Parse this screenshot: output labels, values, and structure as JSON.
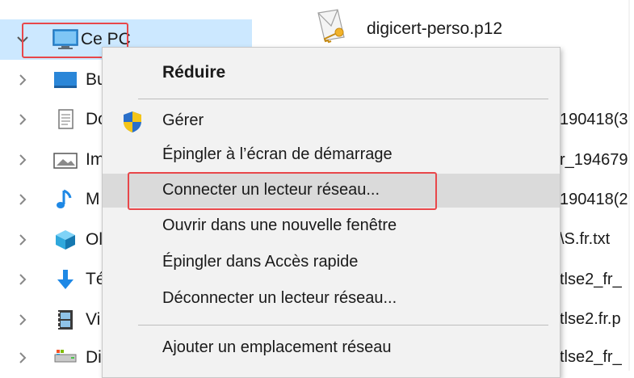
{
  "nav": {
    "items": [
      {
        "label": "Ce PC",
        "icon": "monitor-icon",
        "expanded": true
      },
      {
        "label": "Bu",
        "icon": "desktop-icon"
      },
      {
        "label": "Do",
        "icon": "documents-icon"
      },
      {
        "label": "Im",
        "icon": "images-icon"
      },
      {
        "label": "M",
        "icon": "music-icon"
      },
      {
        "label": "Ol",
        "icon": "objects-3d-icon"
      },
      {
        "label": "Té",
        "icon": "downloads-icon"
      },
      {
        "label": "Vi",
        "icon": "videos-icon"
      },
      {
        "label": "Di",
        "icon": "drive-icon"
      }
    ]
  },
  "files": {
    "top_file": "digicert-perso.p12",
    "fragments": [
      "190418(3",
      "r_194679",
      "190418(2",
      "\\S.fr.txt",
      "tlse2_fr_",
      "tlse2.fr.p",
      "tlse2_fr_"
    ]
  },
  "context_menu": {
    "header": "Réduire",
    "items": [
      {
        "label": "Gérer",
        "icon": "shield-icon"
      },
      {
        "label": "Épingler à l’écran de démarrage"
      },
      {
        "label": "Connecter un lecteur réseau...",
        "hovered": true
      },
      {
        "label": "Ouvrir dans une nouvelle fenêtre"
      },
      {
        "label": "Épingler dans Accès rapide"
      },
      {
        "label": "Déconnecter un lecteur réseau..."
      },
      {
        "label": "Ajouter un emplacement réseau"
      }
    ]
  },
  "colors": {
    "selection": "#cce8ff",
    "highlight_box": "#e8474a",
    "menu_bg": "#f2f2f2",
    "menu_hover": "#dadada"
  }
}
